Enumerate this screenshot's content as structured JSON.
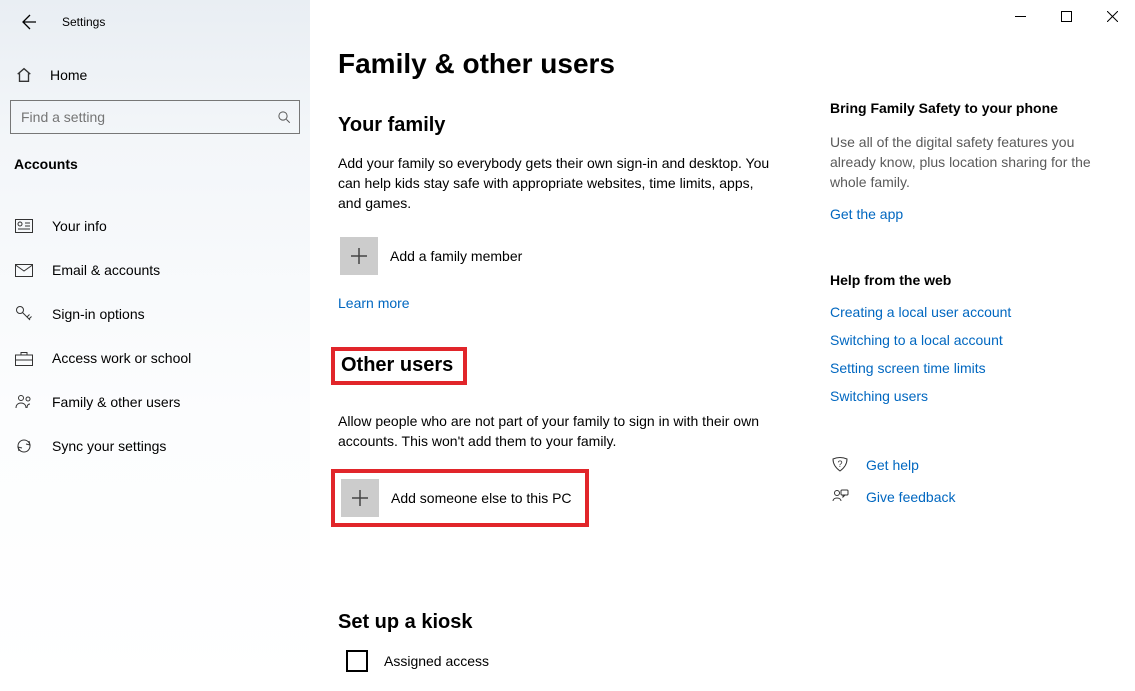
{
  "app_title": "Settings",
  "home_label": "Home",
  "search_placeholder": "Find a setting",
  "sidebar_heading": "Accounts",
  "nav": [
    {
      "label": "Your info"
    },
    {
      "label": "Email & accounts"
    },
    {
      "label": "Sign-in options"
    },
    {
      "label": "Access work or school"
    },
    {
      "label": "Family & other users"
    },
    {
      "label": "Sync your settings"
    }
  ],
  "page": {
    "title": "Family & other users",
    "family": {
      "heading": "Your family",
      "body": "Add your family so everybody gets their own sign-in and desktop. You can help kids stay safe with appropriate websites, time limits, apps, and games.",
      "add_label": "Add a family member",
      "learn_more": "Learn more"
    },
    "other": {
      "heading": "Other users",
      "body": "Allow people who are not part of your family to sign in with their own accounts. This won't add them to your family.",
      "add_label": "Add someone else to this PC"
    },
    "kiosk": {
      "heading": "Set up a kiosk",
      "assigned": "Assigned access"
    }
  },
  "aside": {
    "promo_heading": "Bring Family Safety to your phone",
    "promo_body": "Use all of the digital safety features you already know, plus location sharing for the whole family.",
    "get_app": "Get the app",
    "help_heading": "Help from the web",
    "help_links": [
      "Creating a local user account",
      "Switching to a local account",
      "Setting screen time limits",
      "Switching users"
    ],
    "get_help": "Get help",
    "feedback": "Give feedback"
  }
}
